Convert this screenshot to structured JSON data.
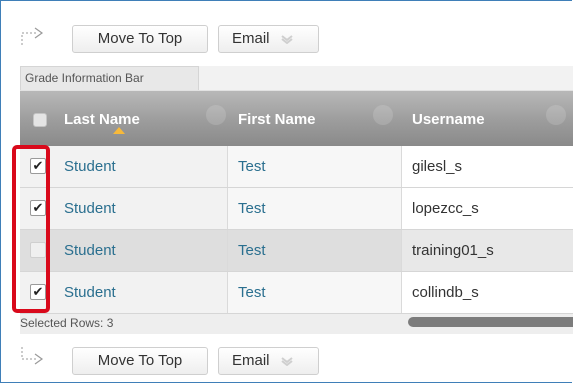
{
  "toolbar_top": {
    "move_to_top": "Move To Top",
    "email": "Email"
  },
  "toolbar_bottom": {
    "move_to_top": "Move To Top",
    "email": "Email"
  },
  "grade_info_bar": {
    "label": "Grade Information Bar"
  },
  "columns": [
    "Last Name",
    "First Name",
    "Username"
  ],
  "rows": [
    {
      "checked": true,
      "last": "Student",
      "first": "Test",
      "username": "gilesl_s"
    },
    {
      "checked": true,
      "last": "Student",
      "first": "Test",
      "username": "lopezcc_s"
    },
    {
      "checked": false,
      "last": "Student",
      "first": "Test",
      "username": "training01_s"
    },
    {
      "checked": true,
      "last": "Student",
      "first": "Test",
      "username": "collindb_s"
    }
  ],
  "footer": {
    "selected_rows": "Selected Rows: 3"
  },
  "colors": {
    "highlight": "#d9091b",
    "link": "#2a6f8f",
    "header": "#9c9c9c",
    "sort_indicator": "#f7b93a"
  },
  "icons": [
    "indent-arrow-icon",
    "chevron-down-icon",
    "sort-ascending-icon",
    "checkbox-checked-icon"
  ]
}
